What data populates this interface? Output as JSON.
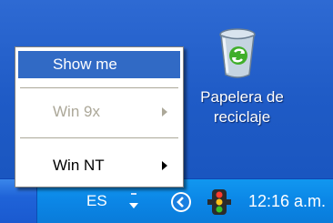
{
  "desktop": {
    "recycle_bin": {
      "label_line1": "Papelera de",
      "label_line2": "reciclaje",
      "icon": "recycle-bin-icon"
    }
  },
  "context_menu": {
    "items": [
      {
        "label": "Show me",
        "state": "selected"
      },
      {
        "label": "Win 9x",
        "state": "disabled",
        "submenu": true
      },
      {
        "label": "Win NT",
        "state": "enabled",
        "submenu": true
      }
    ]
  },
  "taskbar": {
    "language": "ES",
    "clock": "12:16 a.m.",
    "tray_icons": [
      "language-bar-arrow-icon",
      "show-hidden-icons-chevron-icon",
      "traffic-light-icon"
    ]
  },
  "colors": {
    "desktop": "#2563cf",
    "menu_highlight": "#316ac5",
    "tray": "#0b86e6"
  }
}
